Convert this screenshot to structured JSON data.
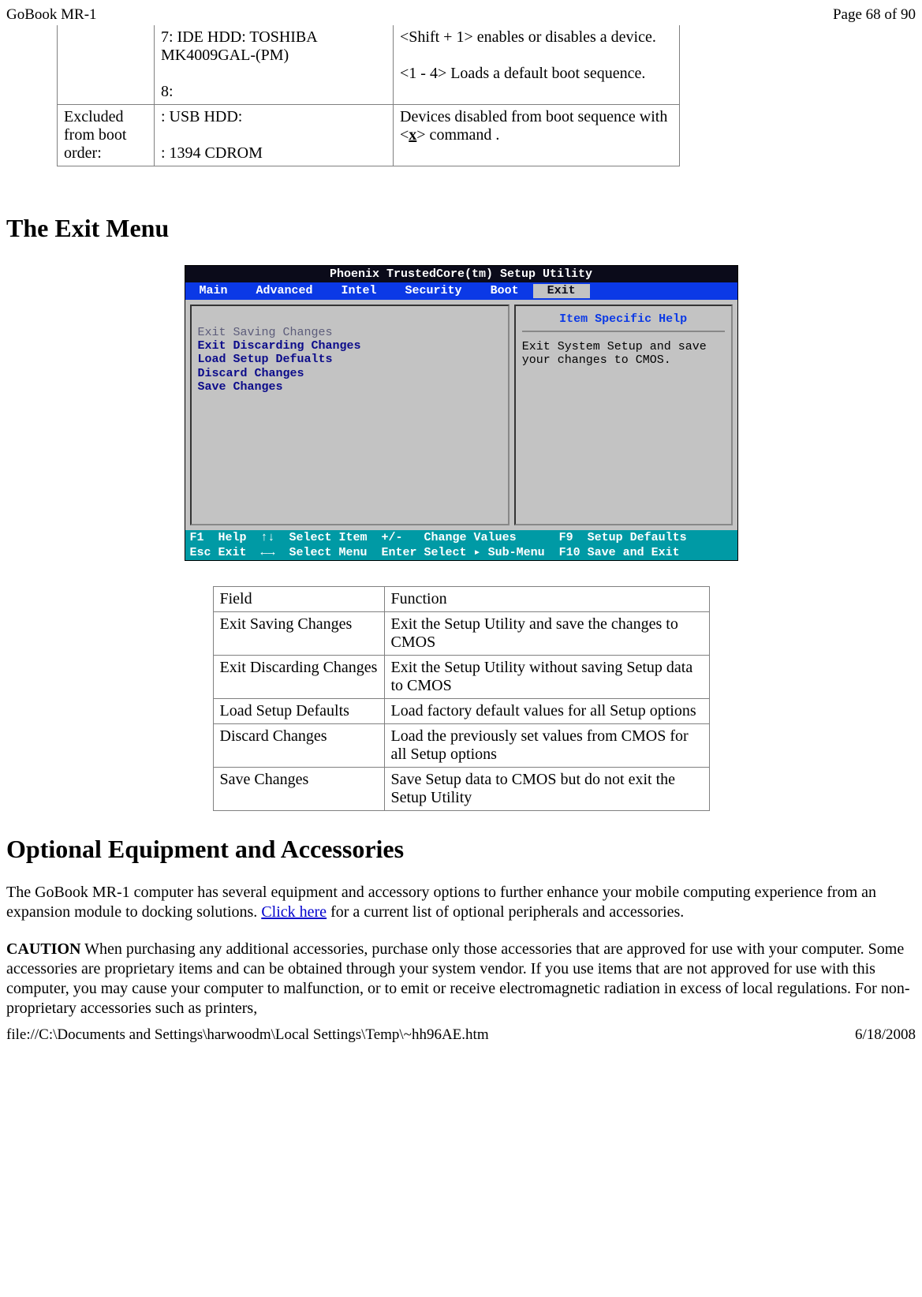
{
  "header": {
    "left": "GoBook MR-1",
    "right": "Page 68 of 90"
  },
  "footer": {
    "left": "file://C:\\Documents and Settings\\harwoodm\\Local Settings\\Temp\\~hh96AE.htm",
    "right": "6/18/2008"
  },
  "topTable": {
    "row1": {
      "col1": "",
      "col2_line1": "7: IDE HDD: TOSHIBA MK4009GAL-(PM)",
      "col2_line2": "8:",
      "col3_line1": "<Shift + 1> enables or disables a device.",
      "col3_line2": "<1 - 4> Loads a default boot sequence."
    },
    "row2": {
      "col1": "Excluded from boot order:",
      "col2_line1": " : USB HDD:",
      "col2_line2": " : 1394 CDROM",
      "col3_pre": " Devices disabled from boot sequence with <",
      "col3_x": "x",
      "col3_post": "> command ."
    }
  },
  "heading1": "The Exit Menu",
  "bios": {
    "title": "Phoenix TrustedCore(tm) Setup Utility",
    "tabs": [
      "Main",
      "Advanced",
      "Intel",
      "Security",
      "Boot",
      "Exit"
    ],
    "selectedTab": "Exit",
    "menu": {
      "dim": "Exit Saving Changes",
      "items": [
        "Exit Discarding Changes",
        "Load Setup Defualts",
        "Discard Changes",
        "Save Changes"
      ]
    },
    "help": {
      "title": "Item Specific Help",
      "text": "Exit System Setup and save your changes to CMOS."
    },
    "footer1": "F1  Help  ↑↓  Select Item  +/-   Change Values      F9  Setup Defaults",
    "footer2": "Esc Exit  ←→  Select Menu  Enter Select ▸ Sub-Menu  F10 Save and Exit"
  },
  "funcTable": {
    "header": {
      "c1": "Field",
      "c2": "Function"
    },
    "rows": [
      {
        "c1": "Exit Saving Changes",
        "c2": "Exit the Setup Utility and save the changes to CMOS"
      },
      {
        "c1": "Exit Discarding Changes",
        "c2": "Exit the Setup Utility without saving Setup data to CMOS"
      },
      {
        "c1": "Load Setup Defaults",
        "c2": "Load factory default values for all Setup options"
      },
      {
        "c1": "Discard Changes",
        "c2": "Load the previously set values from CMOS for all Setup options"
      },
      {
        "c1": "Save Changes",
        "c2": "Save Setup data to CMOS but do not exit the Setup Utility"
      }
    ]
  },
  "heading2": "Optional Equipment and Accessories",
  "para1_pre": "The GoBook MR-1 computer has several equipment and accessory options to further enhance your mobile computing experience from an expansion module to docking solutions.  ",
  "para1_link": "Click here",
  "para1_post": " for a current list of optional peripherals and accessories.",
  "para2_label": "CAUTION",
  "para2_body": "   When purchasing any additional accessories, purchase only those accessories that are approved for use with your computer. Some accessories are proprietary items and can be obtained through your system vendor. If you use items that are not approved for use with this computer, you may cause your computer to malfunction, or to emit or receive electromagnetic radiation in excess of local regulations. For non-proprietary accessories such as printers,"
}
